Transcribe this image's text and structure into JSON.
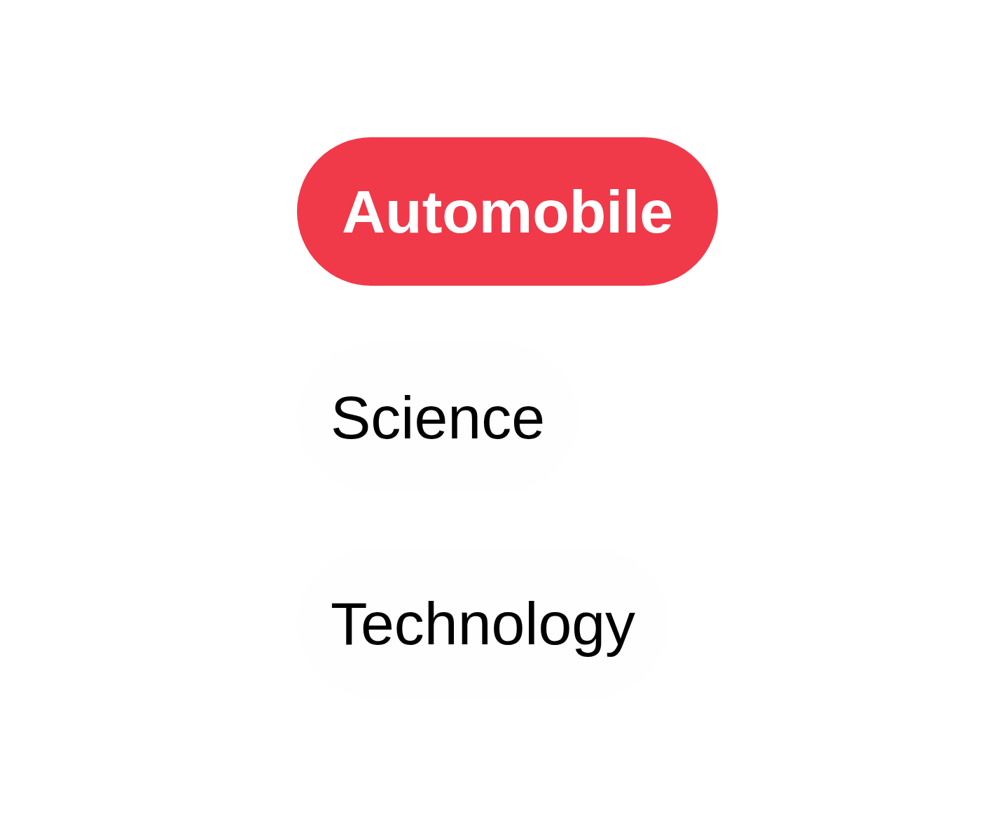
{
  "tags": [
    {
      "label": "Automobile",
      "selected": true
    },
    {
      "label": "Science",
      "selected": false
    },
    {
      "label": "Technology",
      "selected": false
    }
  ]
}
